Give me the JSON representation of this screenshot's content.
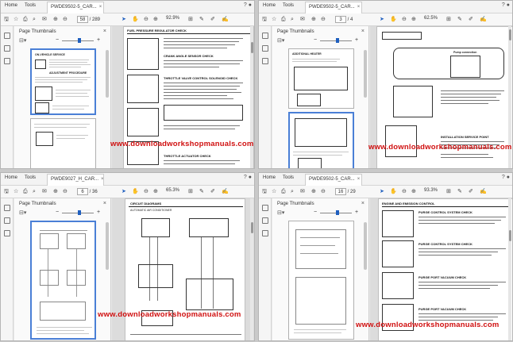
{
  "watermark": "www.downloadworkshopmanuals.com",
  "colors": {
    "watermark": "#d01010",
    "accent": "#1f5fbf"
  },
  "common": {
    "home_tab": "Home",
    "tools_tab": "Tools",
    "panel_title": "Page Thumbnails"
  },
  "q1": {
    "doc_tab": "PWDE9502-5_CAR...",
    "page_current": "58",
    "page_total": "/ 289",
    "zoom": "92.9%",
    "page_text": {
      "header_left": "FUEL PRESSURE REGULATOR CHECK",
      "sec_a": "CRANK ANGLE SENSOR CHECK",
      "sec_b": "THROTTLE VALVE CONTROL SOLENOID CHECK",
      "sec_c": "THROTTLE ACTUATOR CHECK",
      "left_a": "ON-VEHICLE SERVICE",
      "left_b": "ADJUSTMENT PROCEDURE"
    }
  },
  "q2": {
    "doc_tab": "PWDE9502-5_CAR...",
    "page_current": "3",
    "page_total": "/ 4",
    "zoom": "62.5%",
    "page_text": {
      "title_a": "ADDITIONAL HEATER",
      "title_b": "INSTALLATION SERVICE POINT",
      "label_a": "Pump connection"
    }
  },
  "q3": {
    "doc_tab": "PWDE9027_H_CAR...",
    "page_current": "6",
    "page_total": "/ 36",
    "zoom": "65.3%",
    "page_text": {
      "header": "CIRCUIT DIAGRAMS",
      "sub": "AUTOMATIC AIR CONDITIONER"
    }
  },
  "q4": {
    "doc_tab": "PWDE9502-5_CAR...",
    "page_current": "16",
    "page_total": "/ 29",
    "zoom": "93.3%",
    "page_text": {
      "header": "ENGINE AND EMISSION CONTROL",
      "sec_a": "PURGE CONTROL SYSTEM CHECK",
      "sec_b": "PURGE CONTROL SYSTEM CHECK",
      "sec_c": "PURGE PORT VACUUM CHECK",
      "sec_d": "PURGE PORT VACUUM CHECK"
    }
  }
}
